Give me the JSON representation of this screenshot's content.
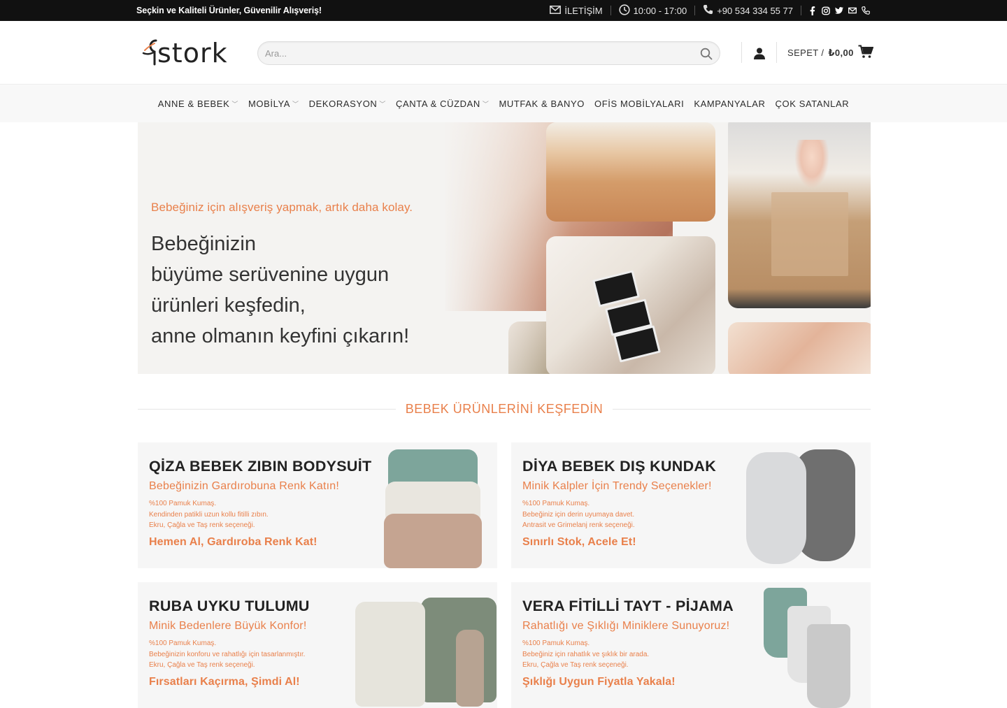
{
  "topbar": {
    "tagline": "Seçkin ve Kaliteli Ürünler, Güvenilir Alışveriş!",
    "contact_label": "İLETİŞİM",
    "hours": "10:00 - 17:00",
    "phone": "+90 534 334 55 77",
    "social_icons": [
      "facebook-icon",
      "instagram-icon",
      "twitter-icon",
      "email-icon",
      "phone-icon"
    ]
  },
  "header": {
    "logo_text": "stork",
    "search_placeholder": "Ara...",
    "cart_label": "SEPET /",
    "cart_amount": "₺0,00"
  },
  "nav": {
    "items": [
      {
        "label": "ANNE & BEBEK",
        "has_dropdown": true
      },
      {
        "label": "MOBİLYA",
        "has_dropdown": true
      },
      {
        "label": "DEKORASYON",
        "has_dropdown": true
      },
      {
        "label": "ÇANTA & CÜZDAN",
        "has_dropdown": true
      },
      {
        "label": "MUTFAK & BANYO",
        "has_dropdown": false
      },
      {
        "label": "OFİS MOBİLYALARI",
        "has_dropdown": false
      },
      {
        "label": "KAMPANYALAR",
        "has_dropdown": false
      },
      {
        "label": "ÇOK SATANLAR",
        "has_dropdown": false
      }
    ]
  },
  "hero": {
    "subtitle": "Bebeğiniz için alışveriş yapmak, artık daha kolay.",
    "title_lines": [
      "Bebeğinizin",
      "büyüme serüvenine uygun",
      "ürünleri keşfedin,",
      "anne olmanın keyfini çıkarın!"
    ]
  },
  "section": {
    "heading": "BEBEK ÜRÜNLERİNİ KEŞFEDİN"
  },
  "cards": [
    {
      "title": "QİZA BEBEK ZIBIN BODYSUİT",
      "subtitle": "Bebeğinizin Gardırobuna Renk Katın!",
      "details": [
        "%100 Pamuk Kumaş.",
        "Kendinden patikli uzun kollu fitilli zıbın.",
        "Ekru, Çağla ve Taş renk seçeneği."
      ],
      "cta": "Hemen Al, Gardıroba Renk Kat!"
    },
    {
      "title": "DİYA BEBEK DIŞ KUNDAK",
      "subtitle": "Minik Kalpler İçin Trendy Seçenekler!",
      "details": [
        "%100 Pamuk Kumaş.",
        "Bebeğiniz için derin uyumaya davet.",
        "Antrasit ve Grimelanj renk seçeneği."
      ],
      "cta": "Sınırlı Stok, Acele Et!"
    },
    {
      "title": "RUBA UYKU TULUMU",
      "subtitle": "Minik Bedenlere Büyük Konfor!",
      "details": [
        "%100 Pamuk Kumaş.",
        "Bebeğinizin konforu ve rahatlığı için tasarlanmıştır.",
        "Ekru, Çağla ve Taş renk seçeneği."
      ],
      "cta": "Fırsatları Kaçırma, Şimdi Al!"
    },
    {
      "title": "VERA FİTİLLİ TAYT - PİJAMA",
      "subtitle": "Rahatlığı ve Şıklığı Miniklere Sunuyoruz!",
      "details": [
        "%100 Pamuk Kumaş.",
        "Bebeğiniz için rahatlık ve şıklık bir arada.",
        "Ekru, Çağla ve Taş renk seçeneği."
      ],
      "cta": "Şıklığı Uygun Fiyatla Yakala!"
    }
  ],
  "colors": {
    "accent": "#e9804b",
    "topbar_bg": "#111111",
    "nav_bg": "#f8f8f8"
  }
}
